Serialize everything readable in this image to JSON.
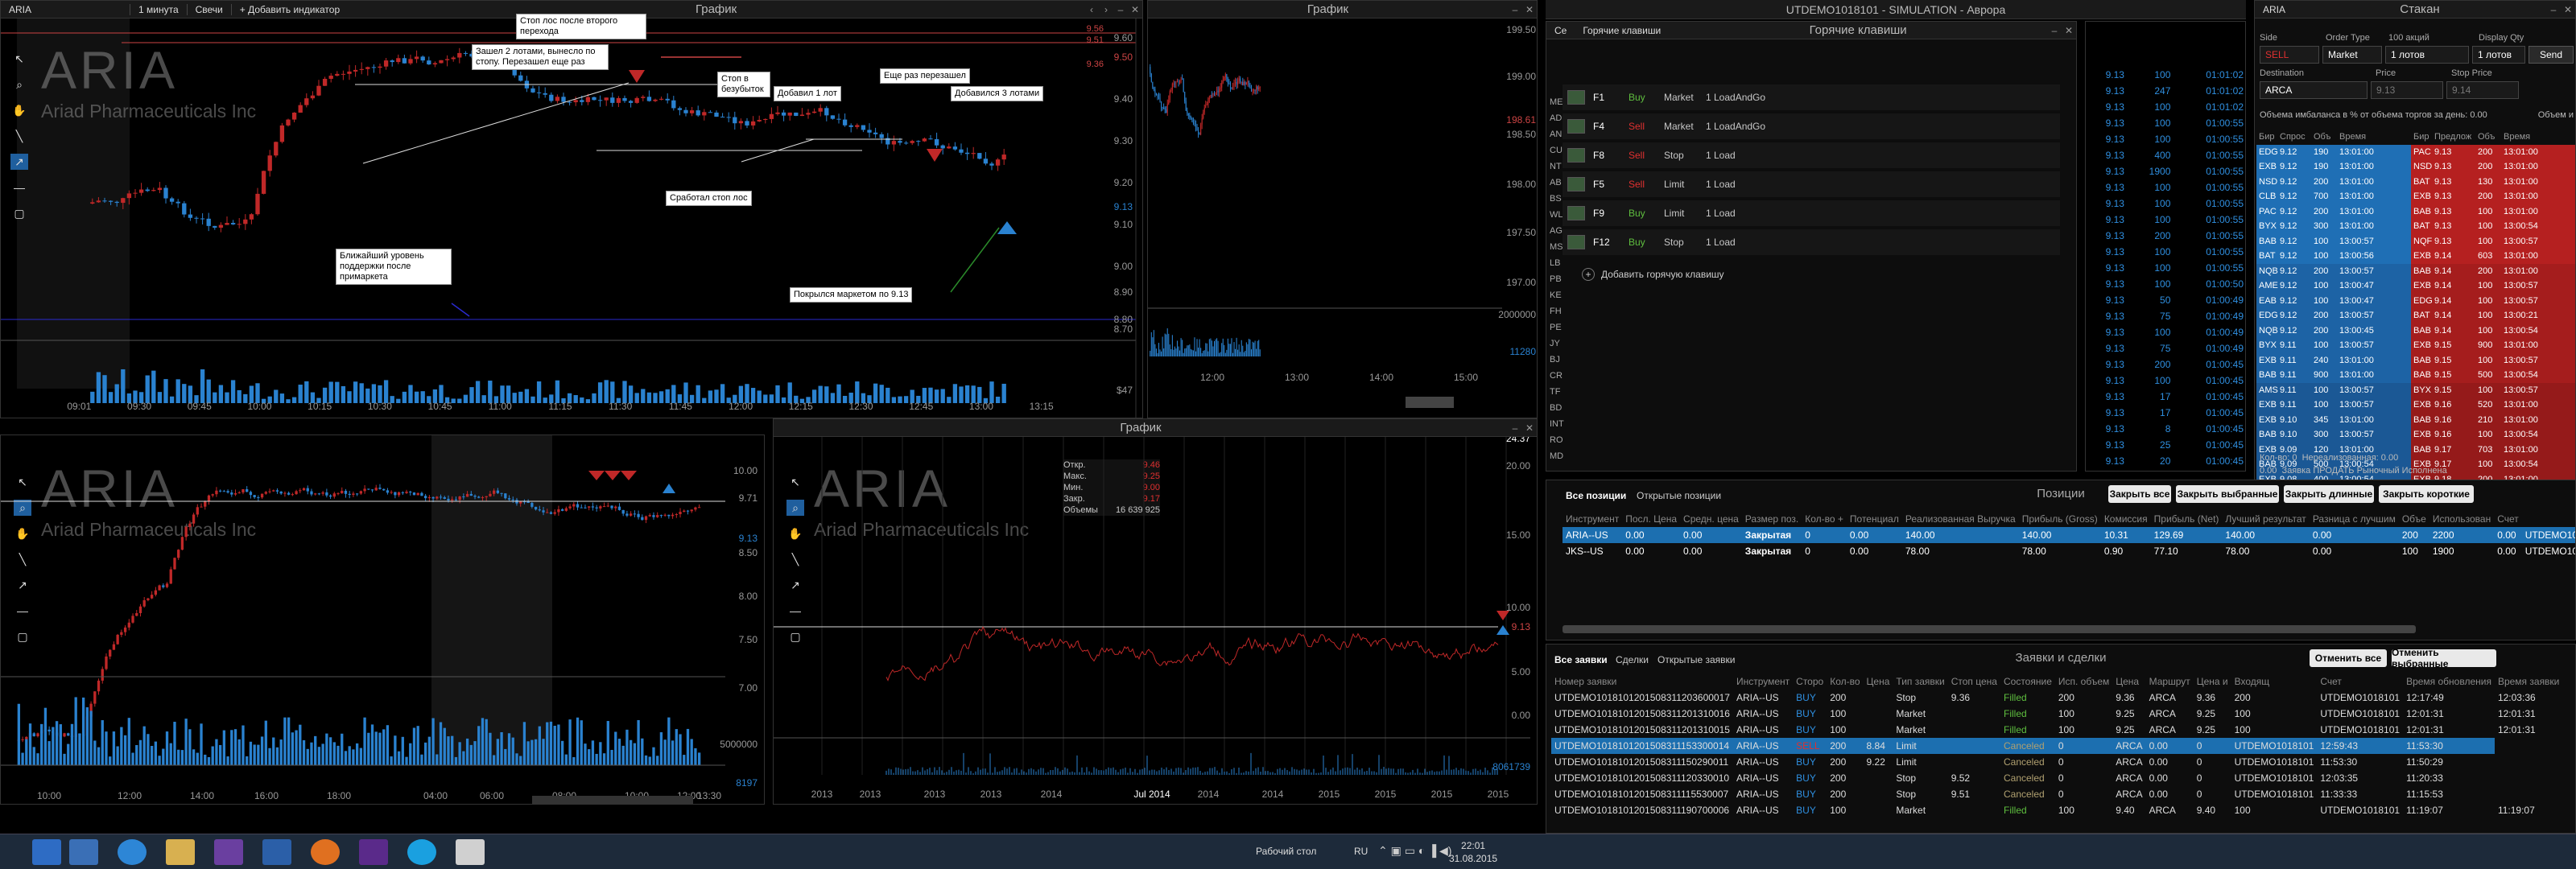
{
  "main_chart": {
    "title": "ARIA",
    "tabs": [
      "1 минута",
      "Свечи",
      "+ Добавить индикатор"
    ],
    "window_title": "График",
    "watermark_symbol": "ARIA",
    "watermark_name": "Ariad Pharmaceuticals Inc",
    "price_labels": [
      "9.60",
      "9.50",
      "9.40",
      "9.30",
      "9.20",
      "9.10",
      "9.00",
      "8.90",
      "8.80",
      "8.70",
      "$47"
    ],
    "current_price": "9.13",
    "level_lines": [
      "9.56",
      "9.51",
      "9.36"
    ],
    "time_labels": [
      "09:01",
      "09:30",
      "09:45",
      "10:00",
      "10:15",
      "10:30",
      "10:45",
      "11:00",
      "11:15",
      "11:30",
      "11:45",
      "12:00",
      "12:15",
      "12:30",
      "12:45",
      "13:00",
      "13:15"
    ],
    "annotations": [
      "Стоп лос после второго перехода",
      "Зашел 2 лотами, вынесло по стопу. Перезашел еще раз",
      "Стоп в безубыток",
      "Добавил 1 лот",
      "Еще раз перезашел",
      "Добавился 3 лотами",
      "Сработал стоп лос",
      "Ближайший уровень поддержки после примаркета",
      "Покрылся маркетом по 9.13"
    ]
  },
  "chart2": {
    "window_title": "График",
    "price_labels": [
      "199.50",
      "199.00",
      "198.61",
      "198.50",
      "198.00",
      "197.50",
      "197.00",
      "2000000",
      "11280"
    ],
    "time_labels": [
      "12:00",
      "13:00",
      "14:00",
      "15:00"
    ]
  },
  "chart3": {
    "watermark_symbol": "ARIA",
    "watermark_name": "Ariad Pharmaceuticals Inc",
    "price_labels": [
      "10.00",
      "9.71",
      "9.13",
      "8.50",
      "8.00",
      "7.50",
      "7.00",
      "5000000",
      "8197"
    ],
    "time_labels": [
      "10:00",
      "12:00",
      "14:00",
      "16:00",
      "18:00",
      "04:00",
      "06:00",
      "08:00",
      "10:00",
      "12:00",
      "13:30"
    ]
  },
  "chart4": {
    "window_title": "График",
    "watermark_symbol": "ARIA",
    "watermark_name": "Ariad Pharmaceuticals Inc",
    "ohlc": {
      "open_label": "Откр.",
      "open": "9.46",
      "high_label": "Макс.",
      "high": "9.25",
      "low_label": "Мин.",
      "low": "9.00",
      "close_label": "Закр.",
      "close": "9.17",
      "volume_label": "Объемы",
      "volume": "16 639 925"
    },
    "price_labels": [
      "24.37",
      "20.00",
      "15.00",
      "10.00",
      "9.13",
      "5.00",
      "0.00",
      "8061739"
    ],
    "time_labels": [
      "2013",
      "2013",
      "2013",
      "2013",
      "2014",
      "Jul 2014",
      "2014",
      "2014",
      "2015",
      "2015",
      "2015",
      "2015"
    ]
  },
  "hotkeys": {
    "app_title": "UTDEMO1018101 - SIMULATION - Аврора",
    "window_title": "Горячие клавиши",
    "label_prefix": "Се",
    "rows": [
      {
        "key": "F1",
        "side": "Buy",
        "type": "Market",
        "qty": "1 LoadAndGo"
      },
      {
        "key": "F4",
        "side": "Sell",
        "type": "Market",
        "qty": "1 LoadAndGo"
      },
      {
        "key": "F8",
        "side": "Sell",
        "type": "Stop",
        "qty": "1 Load"
      },
      {
        "key": "F5",
        "side": "Sell",
        "type": "Limit",
        "qty": "1 Load"
      },
      {
        "key": "F9",
        "side": "Buy",
        "type": "Limit",
        "qty": "1 Load"
      },
      {
        "key": "F12",
        "side": "Buy",
        "type": "Stop",
        "qty": "1 Load"
      }
    ],
    "add_label": "Добавить горячую клавишу",
    "left_col": [
      "ME",
      "AD",
      "AN",
      "CU",
      "NT",
      "AB",
      "BS",
      "WL",
      "AG",
      "MS",
      "LB",
      "PB",
      "KE",
      "FH",
      "PE",
      "JY",
      "BJ",
      "CR",
      "TF",
      "BD",
      "INT",
      "RO",
      "MD"
    ]
  },
  "tape": {
    "rows": [
      [
        "9.13",
        "100",
        "01:01:02"
      ],
      [
        "9.13",
        "247",
        "01:01:02"
      ],
      [
        "9.13",
        "100",
        "01:01:02"
      ],
      [
        "9.13",
        "100",
        "01:00:55"
      ],
      [
        "9.13",
        "100",
        "01:00:55"
      ],
      [
        "9.13",
        "400",
        "01:00:55"
      ],
      [
        "9.13",
        "1900",
        "01:00:55"
      ],
      [
        "9.13",
        "100",
        "01:00:55"
      ],
      [
        "9.13",
        "100",
        "01:00:55"
      ],
      [
        "9.13",
        "100",
        "01:00:55"
      ],
      [
        "9.13",
        "200",
        "01:00:55"
      ],
      [
        "9.13",
        "100",
        "01:00:55"
      ],
      [
        "9.13",
        "100",
        "01:00:55"
      ],
      [
        "9.13",
        "100",
        "01:00:50"
      ],
      [
        "9.13",
        "50",
        "01:00:49"
      ],
      [
        "9.13",
        "75",
        "01:00:49"
      ],
      [
        "9.13",
        "100",
        "01:00:49"
      ],
      [
        "9.13",
        "75",
        "01:00:49"
      ],
      [
        "9.13",
        "200",
        "01:00:45"
      ],
      [
        "9.13",
        "100",
        "01:00:45"
      ],
      [
        "9.13",
        "17",
        "01:00:45"
      ],
      [
        "9.13",
        "17",
        "01:00:45"
      ],
      [
        "9.13",
        "8",
        "01:00:45"
      ],
      [
        "9.13",
        "25",
        "01:00:45"
      ],
      [
        "9.13",
        "20",
        "01:00:45"
      ],
      [
        "9.13",
        "100",
        "01:00:38"
      ],
      [
        "9.13",
        "100",
        "01:00:38"
      ]
    ]
  },
  "order_book": {
    "title": "Стакан",
    "symbol": "ARIA",
    "labels": {
      "side": "Side",
      "order_type": "Order Type",
      "quantity": "100 акций",
      "display_qty": "Display Qty",
      "destination": "Destination",
      "price": "Price",
      "stop_price": "Stop Price"
    },
    "side_value": "SELL",
    "order_type_value": "Market",
    "lots": "1 лотов",
    "lots2": "1 лотов",
    "send": "Send",
    "destination_value": "ARCA",
    "price_value": "9.13",
    "stop_price_value": "9.14",
    "imbalance_label": "Объема имбаланса в % от объема торгов за день:",
    "imbalance_value": "0.00",
    "imbalance_right": "Объем и",
    "columns": [
      "Бир",
      "Спрос",
      "Объ",
      "Время",
      "Бир",
      "Предлож",
      "Объ",
      "Время"
    ],
    "bids": [
      [
        "EDG",
        "9.12",
        "190",
        "13:01:00"
      ],
      [
        "EXB",
        "9.12",
        "190",
        "13:01:00"
      ],
      [
        "NSD",
        "9.12",
        "200",
        "13:01:00"
      ],
      [
        "CLB",
        "9.12",
        "700",
        "13:01:00"
      ],
      [
        "PAC",
        "9.12",
        "200",
        "13:01:00"
      ],
      [
        "BYX",
        "9.12",
        "300",
        "13:01:00"
      ],
      [
        "BAB",
        "9.12",
        "100",
        "13:00:57"
      ],
      [
        "BAT",
        "9.12",
        "100",
        "13:00:56"
      ],
      [
        "NQB",
        "9.12",
        "200",
        "13:00:57"
      ],
      [
        "AME",
        "9.12",
        "100",
        "13:00:47"
      ],
      [
        "EAB",
        "9.12",
        "100",
        "13:00:47"
      ],
      [
        "EDG",
        "9.12",
        "200",
        "13:00:57"
      ],
      [
        "NQB",
        "9.12",
        "200",
        "13:00:45"
      ],
      [
        "BYX",
        "9.11",
        "100",
        "13:00:57"
      ],
      [
        "EXB",
        "9.11",
        "240",
        "13:01:00"
      ],
      [
        "BAB",
        "9.11",
        "900",
        "13:01:00"
      ],
      [
        "AMS",
        "9.11",
        "100",
        "13:00:57"
      ],
      [
        "EXB",
        "9.11",
        "100",
        "13:00:57"
      ],
      [
        "EXB",
        "9.10",
        "345",
        "13:01:00"
      ],
      [
        "BAB",
        "9.10",
        "300",
        "13:00:57"
      ],
      [
        "EXB",
        "9.09",
        "120",
        "13:01:00"
      ],
      [
        "BAB",
        "9.09",
        "500",
        "13:00:54"
      ],
      [
        "EXB",
        "9.08",
        "400",
        "13:00:54"
      ],
      [
        "BAB",
        "9.08",
        "400",
        "13:00:54"
      ]
    ],
    "asks": [
      [
        "PAC",
        "9.13",
        "200",
        "13:01:00"
      ],
      [
        "NSD",
        "9.13",
        "200",
        "13:01:00"
      ],
      [
        "BAT",
        "9.13",
        "130",
        "13:01:00"
      ],
      [
        "EXB",
        "9.13",
        "200",
        "13:01:00"
      ],
      [
        "BAB",
        "9.13",
        "100",
        "13:01:00"
      ],
      [
        "BAT",
        "9.13",
        "100",
        "13:00:54"
      ],
      [
        "NQF",
        "9.13",
        "100",
        "13:00:57"
      ],
      [
        "EXB",
        "9.14",
        "603",
        "13:01:00"
      ],
      [
        "BAB",
        "9.14",
        "200",
        "13:01:00"
      ],
      [
        "EXB",
        "9.14",
        "100",
        "13:00:57"
      ],
      [
        "EDG",
        "9.14",
        "100",
        "13:00:57"
      ],
      [
        "BAT",
        "9.14",
        "100",
        "13:00:21"
      ],
      [
        "BAB",
        "9.14",
        "100",
        "13:00:54"
      ],
      [
        "EXB",
        "9.15",
        "900",
        "13:01:00"
      ],
      [
        "BAB",
        "9.15",
        "100",
        "13:00:57"
      ],
      [
        "BAB",
        "9.15",
        "500",
        "13:00:54"
      ],
      [
        "BYX",
        "9.15",
        "100",
        "13:00:57"
      ],
      [
        "EXB",
        "9.16",
        "520",
        "13:01:00"
      ],
      [
        "BAB",
        "9.16",
        "210",
        "13:01:00"
      ],
      [
        "EXB",
        "9.16",
        "100",
        "13:00:54"
      ],
      [
        "BAB",
        "9.17",
        "703",
        "13:01:00"
      ],
      [
        "EXB",
        "9.17",
        "100",
        "13:00:54"
      ],
      [
        "EXB",
        "9.18",
        "200",
        "13:01:00"
      ]
    ],
    "footer1": "Кол-во:",
    "footer1_val": "0",
    "footer1b": "Нереализованная:",
    "footer1b_val": "0.00",
    "footer2_val": "0.00",
    "footer2": "Заявка ПРОДАТЬ Рыночный Исполнена"
  },
  "positions": {
    "title": "Позиции",
    "tabs": [
      "Все позиции",
      "Открытые позиции"
    ],
    "buttons": [
      "Закрыть все",
      "Закрыть выбранные",
      "Закрыть длинные",
      "Закрыть короткие"
    ],
    "columns": [
      "Инструмент",
      "Посл. Цена",
      "Средн. цена",
      "Размер поз.",
      "Кол-во +",
      "Потенциал",
      "Реализованная Выручка",
      "Прибыль (Gross)",
      "Комиссия",
      "Прибыль (Net)",
      "Лучший результат",
      "Разница с лучшим",
      "Объе",
      "Использован",
      "Счет"
    ],
    "rows": [
      [
        "ARIA--US",
        "0.00",
        "0.00",
        "Закрытая",
        "0",
        "0.00",
        "140.00",
        "140.00",
        "10.31",
        "129.69",
        "140.00",
        "0.00",
        "200",
        "2200",
        "0.00",
        "UTDEMO101"
      ],
      [
        "JKS--US",
        "0.00",
        "0.00",
        "Закрытая",
        "0",
        "0.00",
        "78.00",
        "78.00",
        "0.90",
        "77.10",
        "78.00",
        "0.00",
        "100",
        "1900",
        "0.00",
        "UTDEMO101"
      ]
    ]
  },
  "orders": {
    "title": "Заявки и сделки",
    "tabs": [
      "Все заявки",
      "Сделки",
      "Открытые заявки"
    ],
    "buttons": [
      "Отменить все",
      "Отменить выбранные"
    ],
    "columns": [
      "Номер заявки",
      "Инструмент",
      "Сторо",
      "Кол-во",
      "Цена",
      "Тип заявки",
      "Стоп цена",
      "Состояние",
      "Исп. объем",
      "Цена",
      "Маршрут",
      "Цена и",
      "Входящ",
      "Счет",
      "Время обновления",
      "Время заявки"
    ],
    "rows": [
      [
        "UTDEMO1018101201508311203600017",
        "ARIA--US",
        "BUY",
        "200",
        "",
        "Stop",
        "9.36",
        "Filled",
        "200",
        "9.36",
        "ARCA",
        "9.36",
        "200",
        "UTDEMO1018101",
        "12:17:49",
        "12:03:36"
      ],
      [
        "UTDEMO1018101201508311201310016",
        "ARIA--US",
        "BUY",
        "100",
        "",
        "Market",
        "",
        "Filled",
        "100",
        "9.25",
        "ARCA",
        "9.25",
        "100",
        "UTDEMO1018101",
        "12:01:31",
        "12:01:31"
      ],
      [
        "UTDEMO1018101201508311201310015",
        "ARIA--US",
        "BUY",
        "100",
        "",
        "Market",
        "",
        "Filled",
        "100",
        "9.25",
        "ARCA",
        "9.25",
        "100",
        "UTDEMO1018101",
        "12:01:31",
        "12:01:31"
      ],
      [
        "UTDEMO1018101201508311153300014",
        "ARIA--US",
        "SELL",
        "200",
        "8.84",
        "Limit",
        "",
        "Canceled",
        "0",
        "ARCA",
        "0.00",
        "0",
        "UTDEMO1018101",
        "12:59:43",
        "11:53:30"
      ],
      [
        "UTDEMO1018101201508311150290011",
        "ARIA--US",
        "BUY",
        "200",
        "9.22",
        "Limit",
        "",
        "Canceled",
        "0",
        "ARCA",
        "0.00",
        "0",
        "UTDEMO1018101",
        "11:53:30",
        "11:50:29"
      ],
      [
        "UTDEMO1018101201508311120330010",
        "ARIA--US",
        "BUY",
        "200",
        "",
        "Stop",
        "9.52",
        "Canceled",
        "0",
        "ARCA",
        "0.00",
        "0",
        "UTDEMO1018101",
        "12:03:35",
        "11:20:33"
      ],
      [
        "UTDEMO1018101201508311115530007",
        "ARIA--US",
        "BUY",
        "200",
        "",
        "Stop",
        "9.51",
        "Canceled",
        "0",
        "ARCA",
        "0.00",
        "0",
        "UTDEMO1018101",
        "11:33:33",
        "11:15:53"
      ],
      [
        "UTDEMO1018101201508311190700006",
        "ARIA--US",
        "BUY",
        "100",
        "",
        "Market",
        "",
        "Filled",
        "100",
        "9.40",
        "ARCA",
        "9.40",
        "100",
        "UTDEMO1018101",
        "11:19:07",
        "11:19:07"
      ]
    ]
  },
  "chart2_title": "График",
  "taskbar": {
    "desktop": "Рабочий стол",
    "lang": "RU",
    "time": "22:01",
    "date": "31.08.2015"
  }
}
